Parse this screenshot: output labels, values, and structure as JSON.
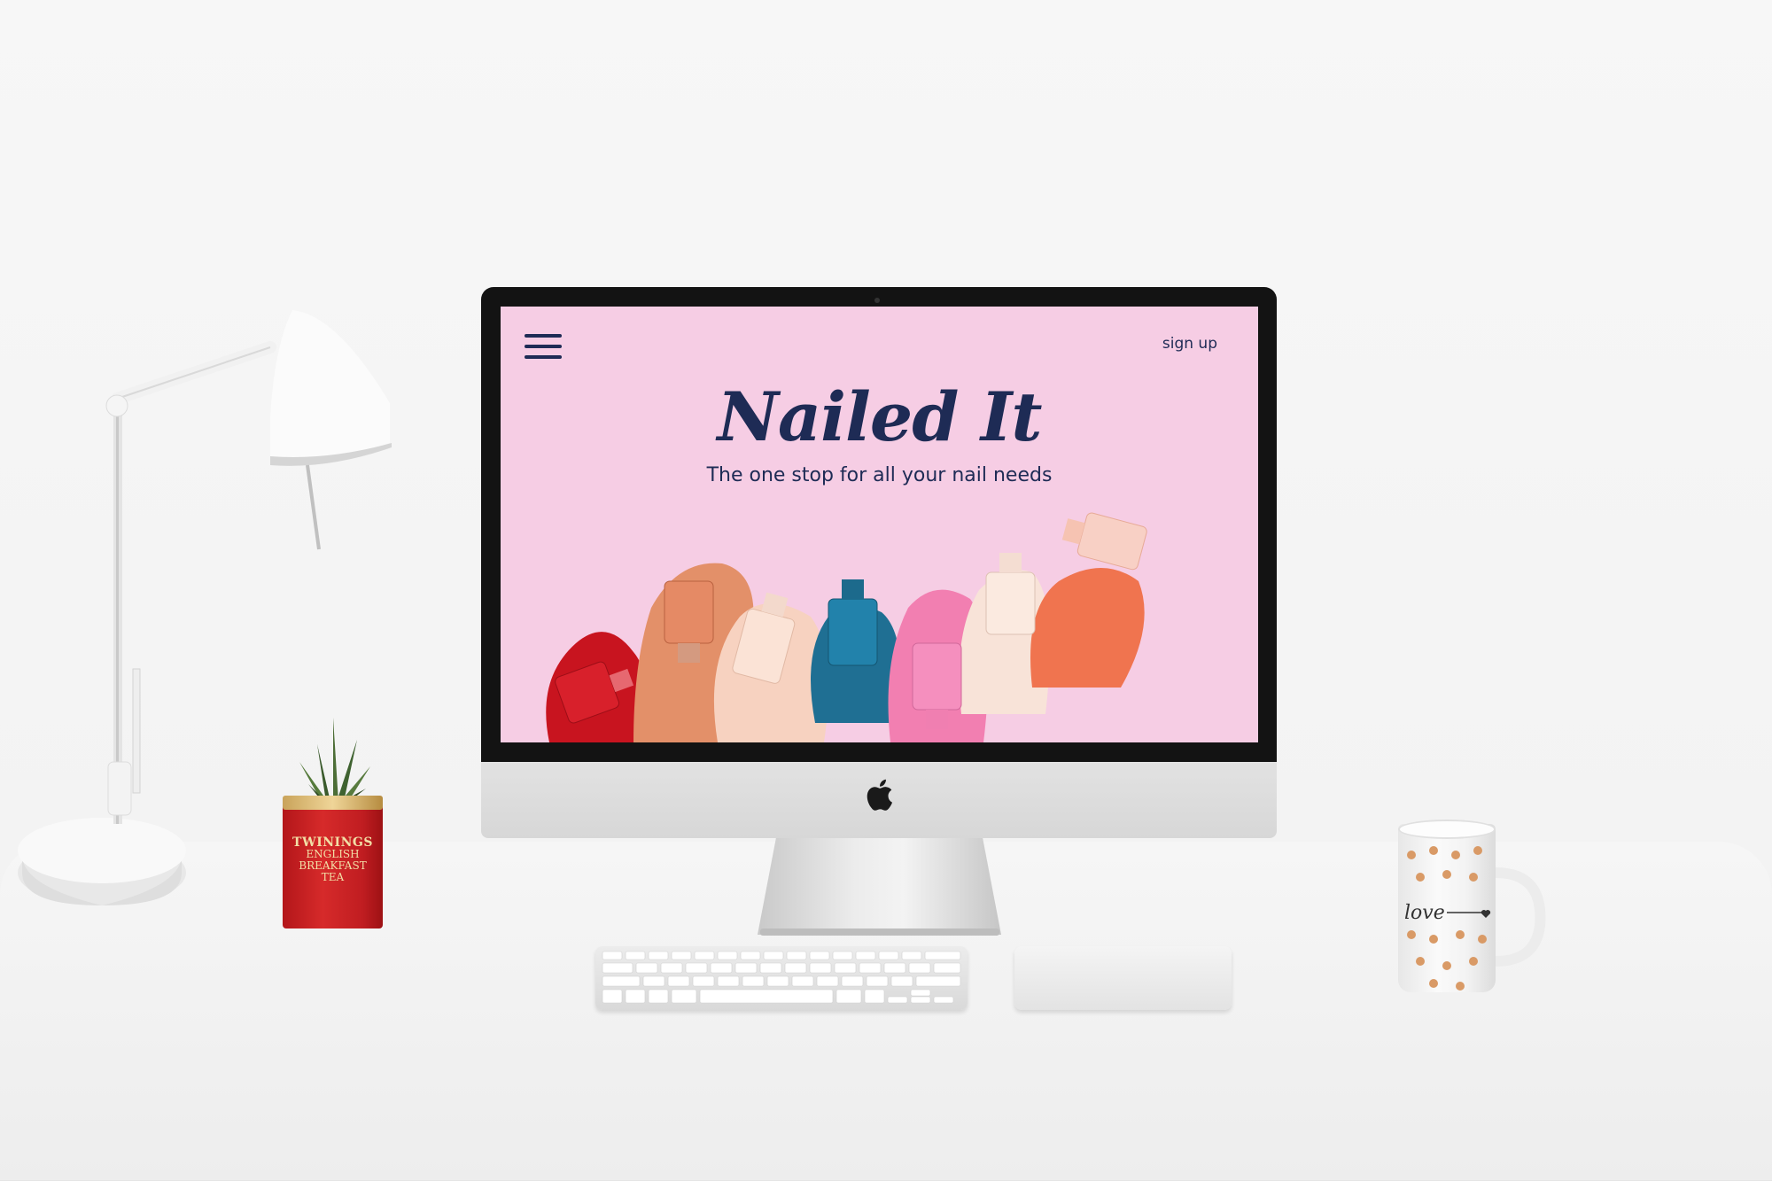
{
  "website": {
    "menu_icon": "hamburger-menu-icon",
    "signup_label": "sign up",
    "title": "Nailed It",
    "tagline": "The one stop for all your nail needs",
    "colors": {
      "background": "#f6cde4",
      "text": "#1e2b55"
    }
  },
  "props": {
    "tin_brand": "TWININGS",
    "tin_line1": "ENGLISH",
    "tin_line2": "BREAKFAST",
    "tin_line3": "TEA",
    "mug_text": "love"
  }
}
